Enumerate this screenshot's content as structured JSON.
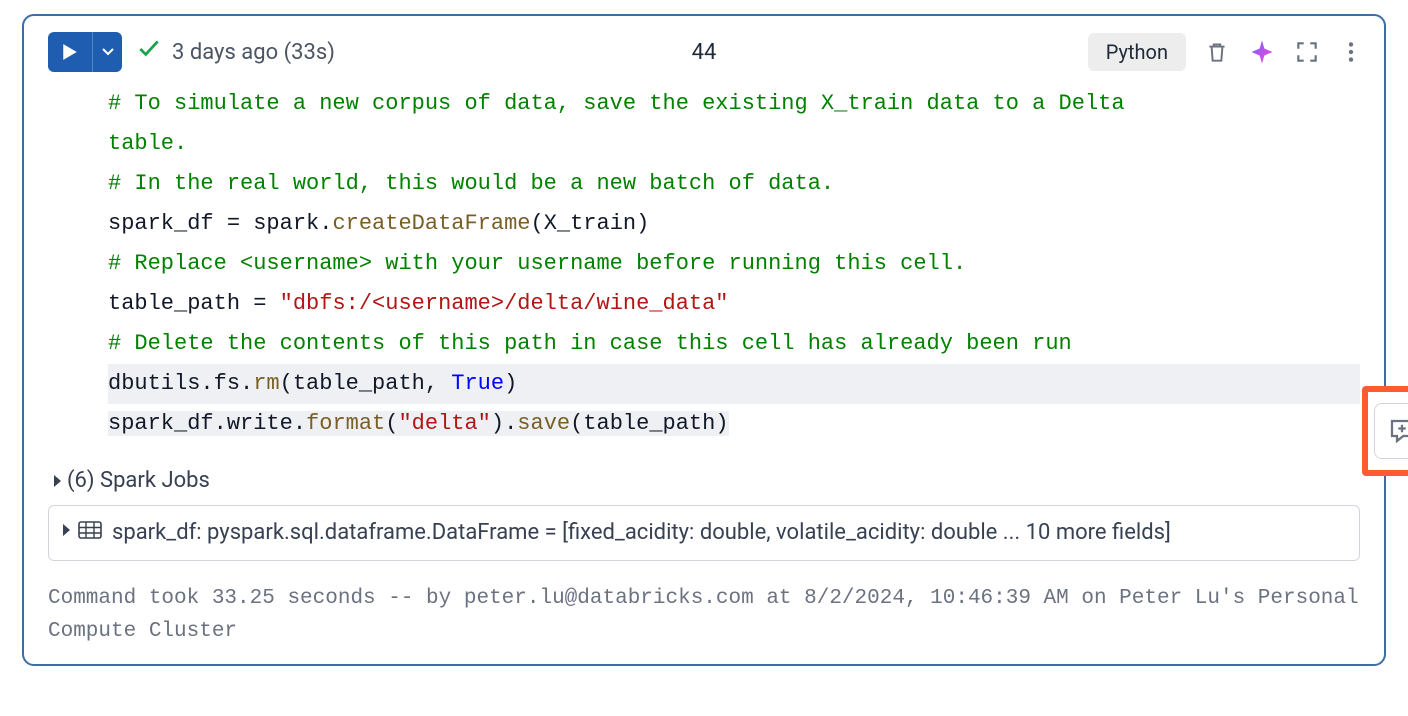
{
  "header": {
    "status_text": "3 days ago (33s)",
    "cell_number": "44",
    "language": "Python"
  },
  "code": {
    "line1_comment_a": "# To simulate a new corpus of data, save the existing X_train data to a Delta",
    "line1_comment_b": "table.",
    "line2_comment": "# In the real world, this would be a new batch of data.",
    "line3_lhs": "spark_df ",
    "line3_eq": "=",
    "line3_sp": " spark.",
    "line3_func": "createDataFrame",
    "line3_args": "(X_train)",
    "line4_comment": "# Replace <username> with your username before running this cell.",
    "line5_lhs": "table_path ",
    "line5_eq": "=",
    "line5_sp": " ",
    "line5_str": "\"dbfs:/<username>/delta/wine_data\"",
    "line6_comment": "# Delete the contents of this path in case this cell has already been run",
    "line7_a": "dbutils.fs.",
    "line7_rm": "rm",
    "line7_b": "(table_path, ",
    "line7_true": "True",
    "line7_c": ")",
    "line8_a": "spark_df.write.",
    "line8_format": "format",
    "line8_b": "(",
    "line8_str": "\"delta\"",
    "line8_c": ").",
    "line8_save": "save",
    "line8_d": "(table_path)"
  },
  "output": {
    "spark_jobs": "(6) Spark Jobs",
    "df_summary": "spark_df:  pyspark.sql.dataframe.DataFrame = [fixed_acidity: double, volatile_acidity: double ... 10 more fields]"
  },
  "footer": {
    "text": "Command took 33.25 seconds -- by peter.lu@databricks.com at 8/2/2024, 10:46:39 AM on Peter Lu's Personal Compute Cluster"
  }
}
